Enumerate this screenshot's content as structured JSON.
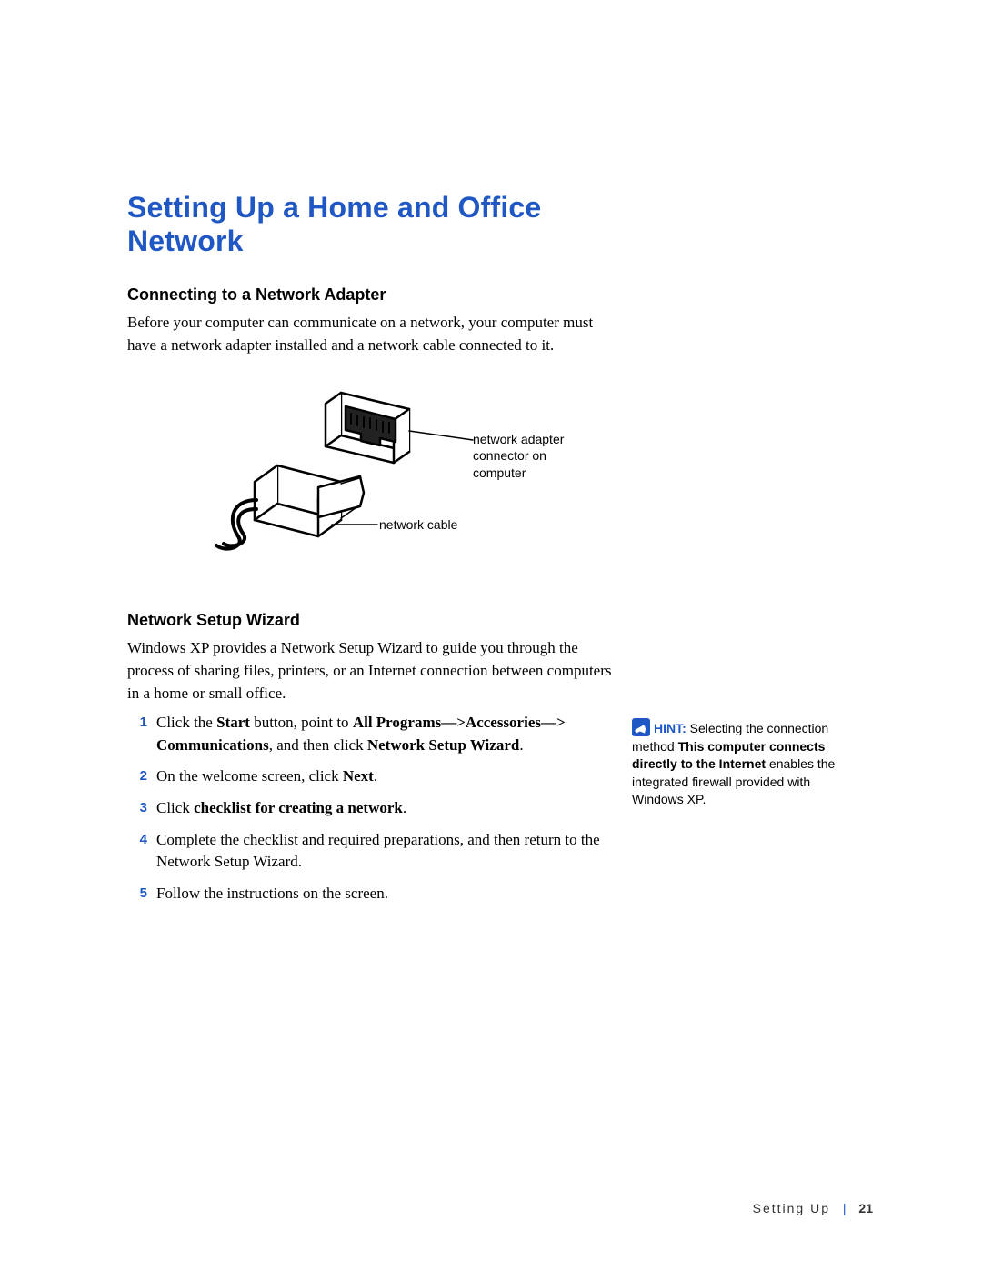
{
  "title": "Setting Up a Home and Office Network",
  "section1": {
    "heading": "Connecting to a Network Adapter",
    "para": "Before your computer can communicate on a network, your computer must have a network adapter installed and a network cable connected to it."
  },
  "figure": {
    "label_adapter": "network adapter connector on computer",
    "label_cable": "network cable"
  },
  "section2": {
    "heading": "Network Setup Wizard",
    "para": "Windows XP provides a Network Setup Wizard to guide you through the process of sharing files, printers, or an Internet connection between computers in a home or small office."
  },
  "steps": {
    "nums": [
      "1",
      "2",
      "3",
      "4",
      "5"
    ],
    "s1_a": "Click the ",
    "s1_b": "Start",
    "s1_c": " button, point to ",
    "s1_d": "All Programs—>Accessories—> Communications",
    "s1_e": ", and then click ",
    "s1_f": "Network Setup Wizard",
    "s1_g": ".",
    "s2_a": "On the welcome screen, click ",
    "s2_b": "Next",
    "s2_c": ".",
    "s3_a": "Click ",
    "s3_b": "checklist for creating a network",
    "s3_c": ".",
    "s4": "Complete the checklist and required preparations, and then return to the Network Setup Wizard.",
    "s5": "Follow the instructions on the screen."
  },
  "hint": {
    "label": "HINT:",
    "a": " Selecting the connection method ",
    "b": "This computer connects directly to the Internet",
    "c": " enables the integrated firewall provided with Windows XP."
  },
  "footer": {
    "section": "Setting Up",
    "sep": "|",
    "page": "21"
  }
}
